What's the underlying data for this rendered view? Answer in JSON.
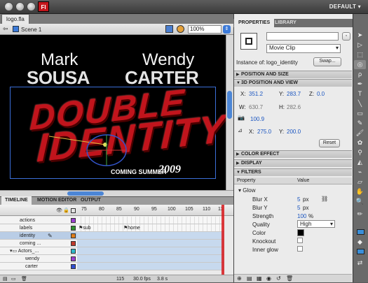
{
  "app": {
    "logo": "Fl",
    "workspace": "DEFAULT"
  },
  "document": {
    "tab": "logo.fla",
    "scene": "Scene 1",
    "zoom": "100%"
  },
  "stage": {
    "name_left_first": "Mark",
    "name_left_last": "SOUSA",
    "name_right_first": "Wendy",
    "name_right_last": "CARTER",
    "title_line1": "DOUBLE",
    "title_line2": "IDENTITY",
    "coming": "COMING SUMMER",
    "year": "2009"
  },
  "timeline": {
    "tabs": [
      "TIMELINE",
      "MOTION EDITOR",
      "OUTPUT"
    ],
    "ticks": [
      "75",
      "80",
      "85",
      "90",
      "95",
      "100",
      "105",
      "110",
      "11"
    ],
    "layers": [
      {
        "name": "actions",
        "color": "#9b3fd1"
      },
      {
        "name": "labels",
        "color": "#2f8f2f"
      },
      {
        "name": "identity",
        "color": "#e07e1a"
      },
      {
        "name": "coming ...",
        "color": "#c0392b"
      },
      {
        "name": "Actors_...",
        "color": "#2fb8c8"
      },
      {
        "name": "wendy",
        "color": "#9b3fd1"
      },
      {
        "name": "carter",
        "color": "#2f4fd1"
      }
    ],
    "frame_labels": [
      "sub",
      "home"
    ],
    "footer": {
      "frame": "115",
      "fps": "30.0 fps",
      "time": "3.8 s"
    }
  },
  "properties": {
    "tabs": [
      "PROPERTIES",
      "LIBRARY"
    ],
    "symbol_type": "Movie Clip",
    "instance_of_label": "Instance of:",
    "instance_of": "logo_identity",
    "swap": "Swap...",
    "sections": {
      "position_size": "POSITION AND SIZE",
      "pos3d": "3D POSITION AND VIEW",
      "color_effect": "COLOR EFFECT",
      "display": "DISPLAY",
      "filters": "FILTERS"
    },
    "x": "351.2",
    "y": "283.7",
    "z": "0.0",
    "w": "630.7",
    "h": "282.6",
    "perspective": "100.9",
    "vx": "275.0",
    "vy": "200.0",
    "reset": "Reset",
    "filter_cols": [
      "Property",
      "Value"
    ],
    "filter_name": "Glow",
    "blur_x_label": "Blur X",
    "blur_x": "5",
    "blur_y_label": "Blur Y",
    "blur_y": "5",
    "px": "px",
    "strength_label": "Strength",
    "strength": "100",
    "pct": "%",
    "quality_label": "Quality",
    "quality": "High",
    "color_label": "Color",
    "knockout_label": "Knockout",
    "inner_glow_label": "Inner glow"
  }
}
